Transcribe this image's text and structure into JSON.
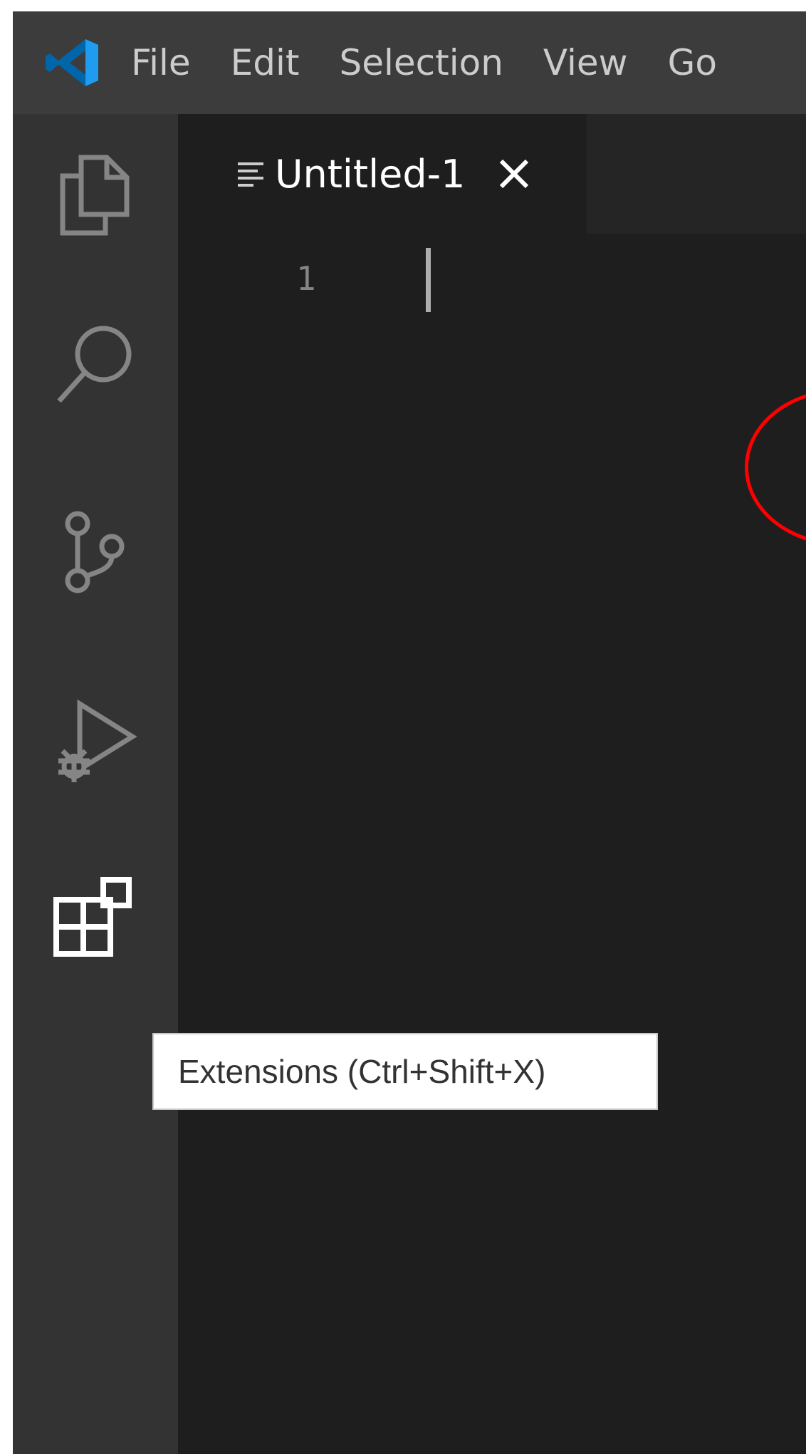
{
  "menubar": {
    "logo_icon": "vscode-logo-icon",
    "logo_color": "#007acc",
    "items": [
      {
        "label": "File"
      },
      {
        "label": "Edit"
      },
      {
        "label": "Selection"
      },
      {
        "label": "View"
      },
      {
        "label": "Go"
      }
    ]
  },
  "activitybar": {
    "items": [
      {
        "icon": "explorer-files-icon",
        "active": false
      },
      {
        "icon": "search-icon",
        "active": false
      },
      {
        "icon": "source-control-icon",
        "active": false
      },
      {
        "icon": "run-debug-icon",
        "active": false
      },
      {
        "icon": "extensions-icon",
        "active": true
      }
    ]
  },
  "tabs": [
    {
      "label": "Untitled-1",
      "icon": "text-file-icon",
      "close_icon": "close-icon",
      "active": true
    }
  ],
  "editor": {
    "line_numbers": [
      "1"
    ]
  },
  "tooltip": {
    "text": "Extensions (Ctrl+Shift+X)"
  },
  "colors": {
    "menubar_bg": "#3c3c3c",
    "activitybar_bg": "#333333",
    "editor_bg": "#1e1e1e",
    "tab_strip_bg": "#252526",
    "annotation": "#ff0000"
  }
}
